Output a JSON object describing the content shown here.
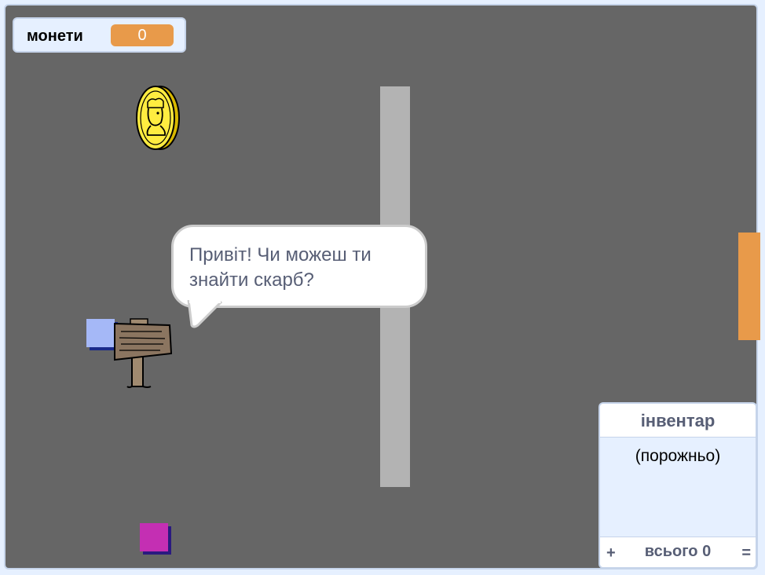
{
  "coins_monitor": {
    "label": "монети",
    "value": "0"
  },
  "speech_bubble": {
    "text": "Привіт! Чи можеш ти знайти скарб?"
  },
  "inventory": {
    "title": "інвентар",
    "empty_text": "(порожньо)",
    "plus": "+",
    "total": "всього 0",
    "equals": "="
  },
  "colors": {
    "stage_background": "#666666",
    "wall": "#b3b3b3",
    "door": "#e89a4a",
    "player": "#a5b8f7",
    "pink_block": "#c42fb3",
    "coin": "#ffec40",
    "monitor_value": "#e89a4a"
  },
  "icons": [
    "gold-coin-icon",
    "wooden-signpost-icon"
  ]
}
